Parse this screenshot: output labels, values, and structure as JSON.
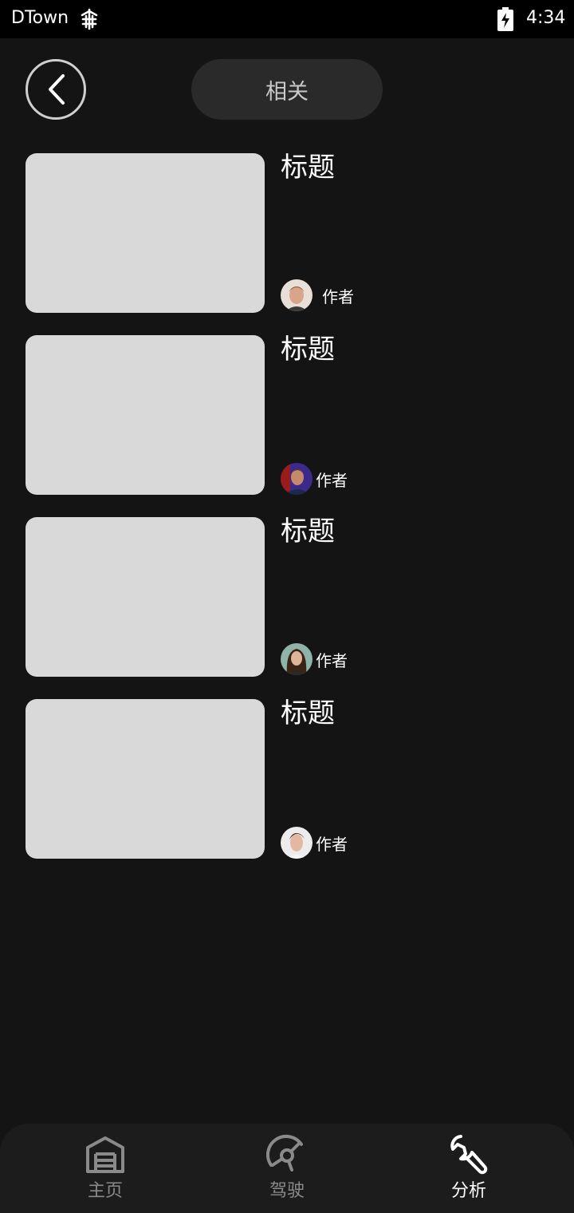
{
  "status_bar": {
    "carrier": "DTown",
    "time": "4:34"
  },
  "header": {
    "tab_label": "相关"
  },
  "articles": [
    {
      "title": "标题",
      "author": "作者"
    },
    {
      "title": "标题",
      "author": "作者"
    },
    {
      "title": "标题",
      "author": "作者"
    },
    {
      "title": "标题",
      "author": "作者"
    }
  ],
  "bottom_nav": {
    "items": [
      {
        "label": "主页",
        "icon": "garage-icon",
        "active": false
      },
      {
        "label": "驾驶",
        "icon": "steering-wheel-icon",
        "active": false
      },
      {
        "label": "分析",
        "icon": "wrench-icon",
        "active": true
      }
    ]
  },
  "colors": {
    "background": "#141414",
    "thumbnail": "#d9d9d9",
    "inactive_nav": "#8a8a8a"
  }
}
